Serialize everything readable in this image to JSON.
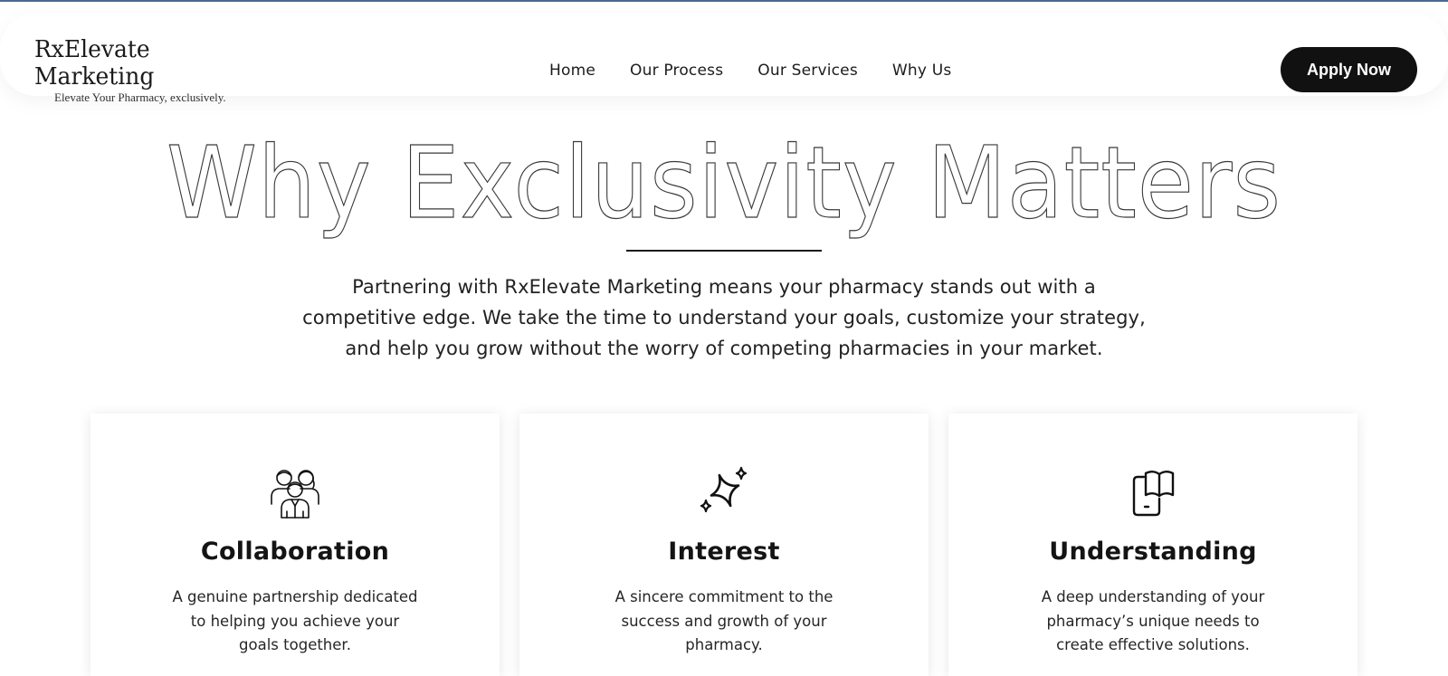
{
  "brand": {
    "name": "RxElevate Marketing",
    "tagline": "Elevate Your Pharmacy, exclusively."
  },
  "nav": {
    "items": [
      {
        "label": "Home"
      },
      {
        "label": "Our Process"
      },
      {
        "label": "Our Services"
      },
      {
        "label": "Why Us"
      }
    ]
  },
  "header": {
    "cta_label": "Apply Now"
  },
  "hero": {
    "title": "Why Exclusivity Matters",
    "description": "Partnering with RxElevate Marketing means your pharmacy stands out with a competitive edge. We take the time to understand your goals, customize your strategy, and help you grow without the worry of competing pharmacies in your market."
  },
  "cards": [
    {
      "icon": "team-icon",
      "title": "Collaboration",
      "text": "A genuine partnership dedicated to helping you achieve your goals together."
    },
    {
      "icon": "sparkle-icon",
      "title": "Interest",
      "text": "A sincere commitment to the success and growth of your pharmacy."
    },
    {
      "icon": "mobile-book-icon",
      "title": "Understanding",
      "text": "A deep understanding of your pharmacy’s unique needs to create effective solutions."
    }
  ],
  "colors": {
    "accent_dark": "#111111",
    "top_rule": "#4a6a8f",
    "background": "#ffffff"
  }
}
